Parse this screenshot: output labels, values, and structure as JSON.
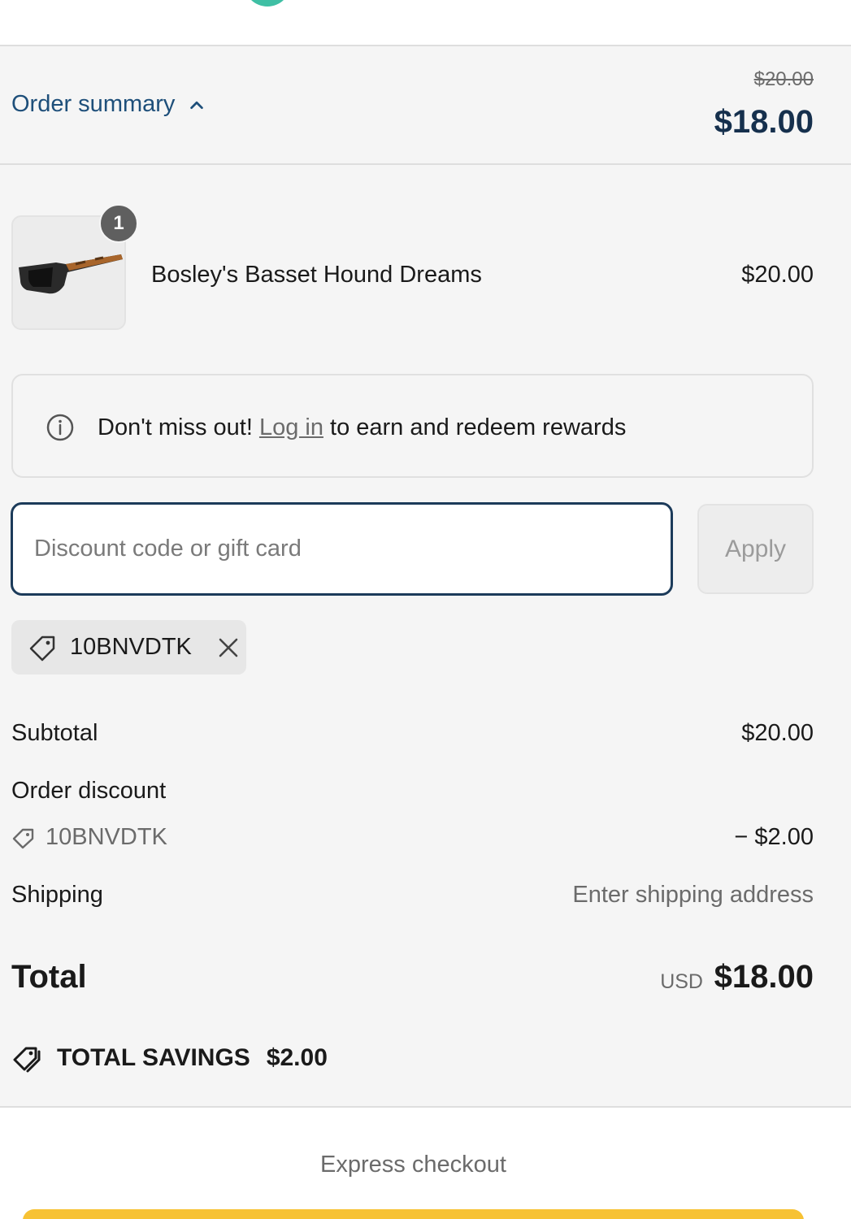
{
  "colors": {
    "accent_link": "#1e4f7a",
    "heading_price": "#16304d",
    "input_border": "#1c3b5a",
    "express_button": "#f7c234",
    "top_dot": "#3fbfa4"
  },
  "summary": {
    "toggle_label": "Order summary",
    "toggle_icon": "chevron-up-icon",
    "original_price": "$20.00",
    "current_price": "$18.00"
  },
  "product": {
    "name": "Bosley's Basset Hound Dreams",
    "price": "$20.00",
    "quantity": "1",
    "image_icon": "sunglasses-icon"
  },
  "rewards": {
    "icon": "info-icon",
    "prefix": "Don't miss out! ",
    "link_text": "Log in",
    "suffix": " to earn and redeem rewards"
  },
  "discount": {
    "placeholder": "Discount code or gift card",
    "apply_label": "Apply",
    "applied_code": "10BNVDTK"
  },
  "totals": {
    "subtotal_label": "Subtotal",
    "subtotal_value": "$20.00",
    "order_discount_label": "Order discount",
    "discount_code": "10BNVDTK",
    "discount_value": "− $2.00",
    "shipping_label": "Shipping",
    "shipping_value": "Enter shipping address",
    "total_label": "Total",
    "currency": "USD",
    "total_value": "$18.00",
    "savings_label": "TOTAL SAVINGS",
    "savings_value": "$2.00"
  },
  "express": {
    "label": "Express checkout"
  }
}
